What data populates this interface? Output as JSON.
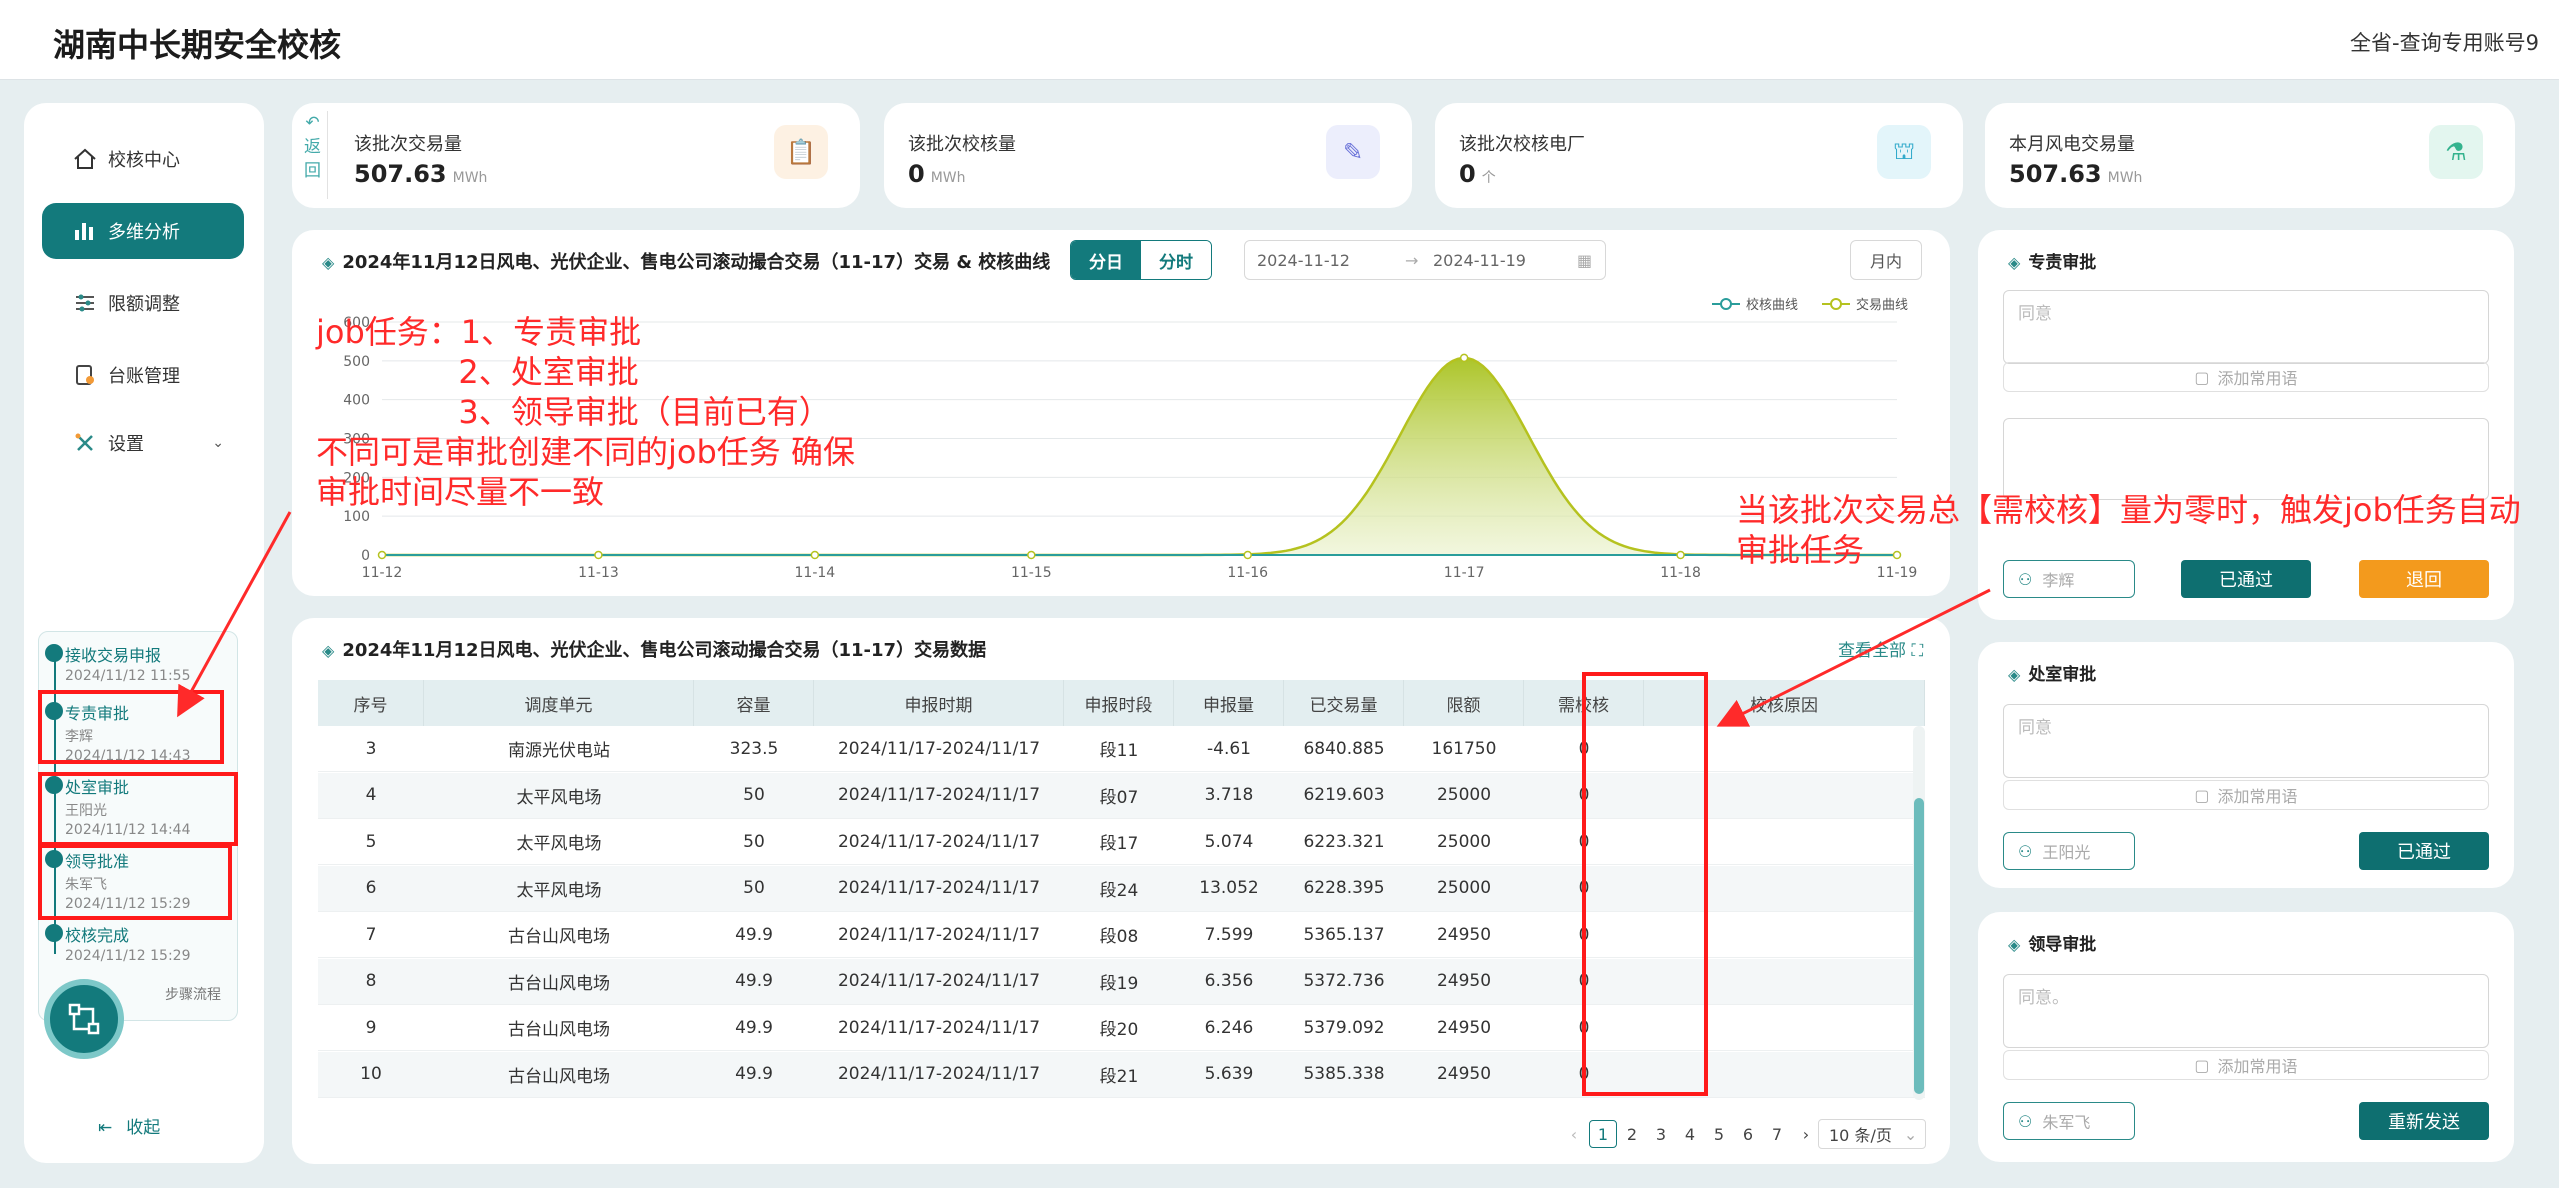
{
  "header": {
    "title": "湖南中长期安全校核",
    "account": "全省-查询专用账号9"
  },
  "sidebar": {
    "items": [
      {
        "label": "校核中心",
        "icon": "home-icon"
      },
      {
        "label": "多维分析",
        "icon": "bar-chart-icon"
      },
      {
        "label": "限额调整",
        "icon": "sliders-icon"
      },
      {
        "label": "台账管理",
        "icon": "ledger-icon"
      },
      {
        "label": "设置",
        "icon": "settings-icon"
      }
    ],
    "steps": [
      {
        "title": "接收交易申报",
        "person": "",
        "time": "2024/11/12 11:55"
      },
      {
        "title": "专责审批",
        "person": "李辉",
        "time": "2024/11/12 14:43"
      },
      {
        "title": "处室审批",
        "person": "王阳光",
        "time": "2024/11/12 14:44"
      },
      {
        "title": "领导批准",
        "person": "朱军飞",
        "time": "2024/11/12 15:29"
      },
      {
        "title": "校核完成",
        "person": "",
        "time": "2024/11/12 15:29"
      }
    ],
    "steps_label": "步骤流程",
    "collapse": "收起"
  },
  "back_label": "返回",
  "stats": [
    {
      "label": "该批次交易量",
      "value": "507.63",
      "unit": "MWh",
      "color": "#f29a37",
      "bg": "#fdf1e3"
    },
    {
      "label": "该批次校核量",
      "value": "0",
      "unit": "MWh",
      "color": "#6b73d9",
      "bg": "#eceefc"
    },
    {
      "label": "该批次校核电厂",
      "value": "0",
      "unit": "个",
      "color": "#32aacb",
      "bg": "#e3f5fa"
    },
    {
      "label": "本月风电交易量",
      "value": "507.63",
      "unit": "MWh",
      "color": "#34b38e",
      "bg": "#e3f6ef"
    }
  ],
  "chart_section": {
    "title": "2024年11月12日风电、光伏企业、售电公司滚动撮合交易（11-17）交易 & 校核曲线",
    "seg": [
      "分日",
      "分时"
    ],
    "date_start": "2024-11-12",
    "date_arrow": "→",
    "date_end": "2024-11-19",
    "month_btn": "月内"
  },
  "chart_data": {
    "type": "area",
    "x": [
      "11-12",
      "11-13",
      "11-14",
      "11-15",
      "11-16",
      "11-17",
      "11-18",
      "11-19"
    ],
    "series": [
      {
        "name": "校核曲线",
        "values": [
          0,
          0,
          0,
          0,
          0,
          0,
          0,
          0
        ],
        "color": "#2a9d9b"
      },
      {
        "name": "交易曲线",
        "values": [
          0,
          0,
          0,
          0,
          0,
          507.63,
          0,
          0
        ],
        "color": "#b5c21f"
      }
    ],
    "y_ticks": [
      0,
      100,
      200,
      300,
      400,
      500,
      600
    ],
    "ylim": [
      0,
      600
    ],
    "grid": true,
    "legend": "top-right"
  },
  "table_section": {
    "title": "2024年11月12日风电、光伏企业、售电公司滚动撮合交易（11-17）交易数据",
    "view_all": "查看全部",
    "columns": [
      "序号",
      "调度单元",
      "容量",
      "申报时期",
      "申报时段",
      "申报量",
      "已交易量",
      "限额",
      "需校核",
      "校核原因"
    ],
    "rows": [
      [
        "3",
        "南源光伏电站",
        "323.5",
        "2024/11/17-2024/11/17",
        "段11",
        "-4.61",
        "6840.885",
        "161750",
        "0",
        ""
      ],
      [
        "4",
        "太平风电场",
        "50",
        "2024/11/17-2024/11/17",
        "段07",
        "3.718",
        "6219.603",
        "25000",
        "0",
        ""
      ],
      [
        "5",
        "太平风电场",
        "50",
        "2024/11/17-2024/11/17",
        "段17",
        "5.074",
        "6223.321",
        "25000",
        "0",
        ""
      ],
      [
        "6",
        "太平风电场",
        "50",
        "2024/11/17-2024/11/17",
        "段24",
        "13.052",
        "6228.395",
        "25000",
        "0",
        ""
      ],
      [
        "7",
        "古台山风电场",
        "49.9",
        "2024/11/17-2024/11/17",
        "段08",
        "7.599",
        "5365.137",
        "24950",
        "0",
        ""
      ],
      [
        "8",
        "古台山风电场",
        "49.9",
        "2024/11/17-2024/11/17",
        "段19",
        "6.356",
        "5372.736",
        "24950",
        "0",
        ""
      ],
      [
        "9",
        "古台山风电场",
        "49.9",
        "2024/11/17-2024/11/17",
        "段20",
        "6.246",
        "5379.092",
        "24950",
        "0",
        ""
      ],
      [
        "10",
        "古台山风电场",
        "49.9",
        "2024/11/17-2024/11/17",
        "段21",
        "5.639",
        "5385.338",
        "24950",
        "0",
        ""
      ]
    ],
    "pages": [
      "1",
      "2",
      "3",
      "4",
      "5",
      "6",
      "7"
    ],
    "page_size": "10 条/页"
  },
  "approvals": [
    {
      "title": "专责审批",
      "placeholder": "同意",
      "phrase": "添加常用语",
      "person": "李辉",
      "buttons": [
        "已通过",
        "退回"
      ]
    },
    {
      "title": "处室审批",
      "placeholder": "同意",
      "phrase": "添加常用语",
      "person": "王阳光",
      "buttons": [
        "已通过"
      ]
    },
    {
      "title": "领导审批",
      "placeholder": "同意。",
      "phrase": "添加常用语",
      "person": "朱军飞",
      "buttons": [
        "重新发送"
      ]
    }
  ],
  "annotations": {
    "job_text": "job任务：1、专责审批\n              2、处室审批\n              3、领导审批（目前已有）\n不同可是审批创建不同的job任务 确保\n审批时间尽量不一致",
    "trigger_text": "当该批次交易总【需校核】量为零时，触发job任务自动\n审批任务"
  }
}
